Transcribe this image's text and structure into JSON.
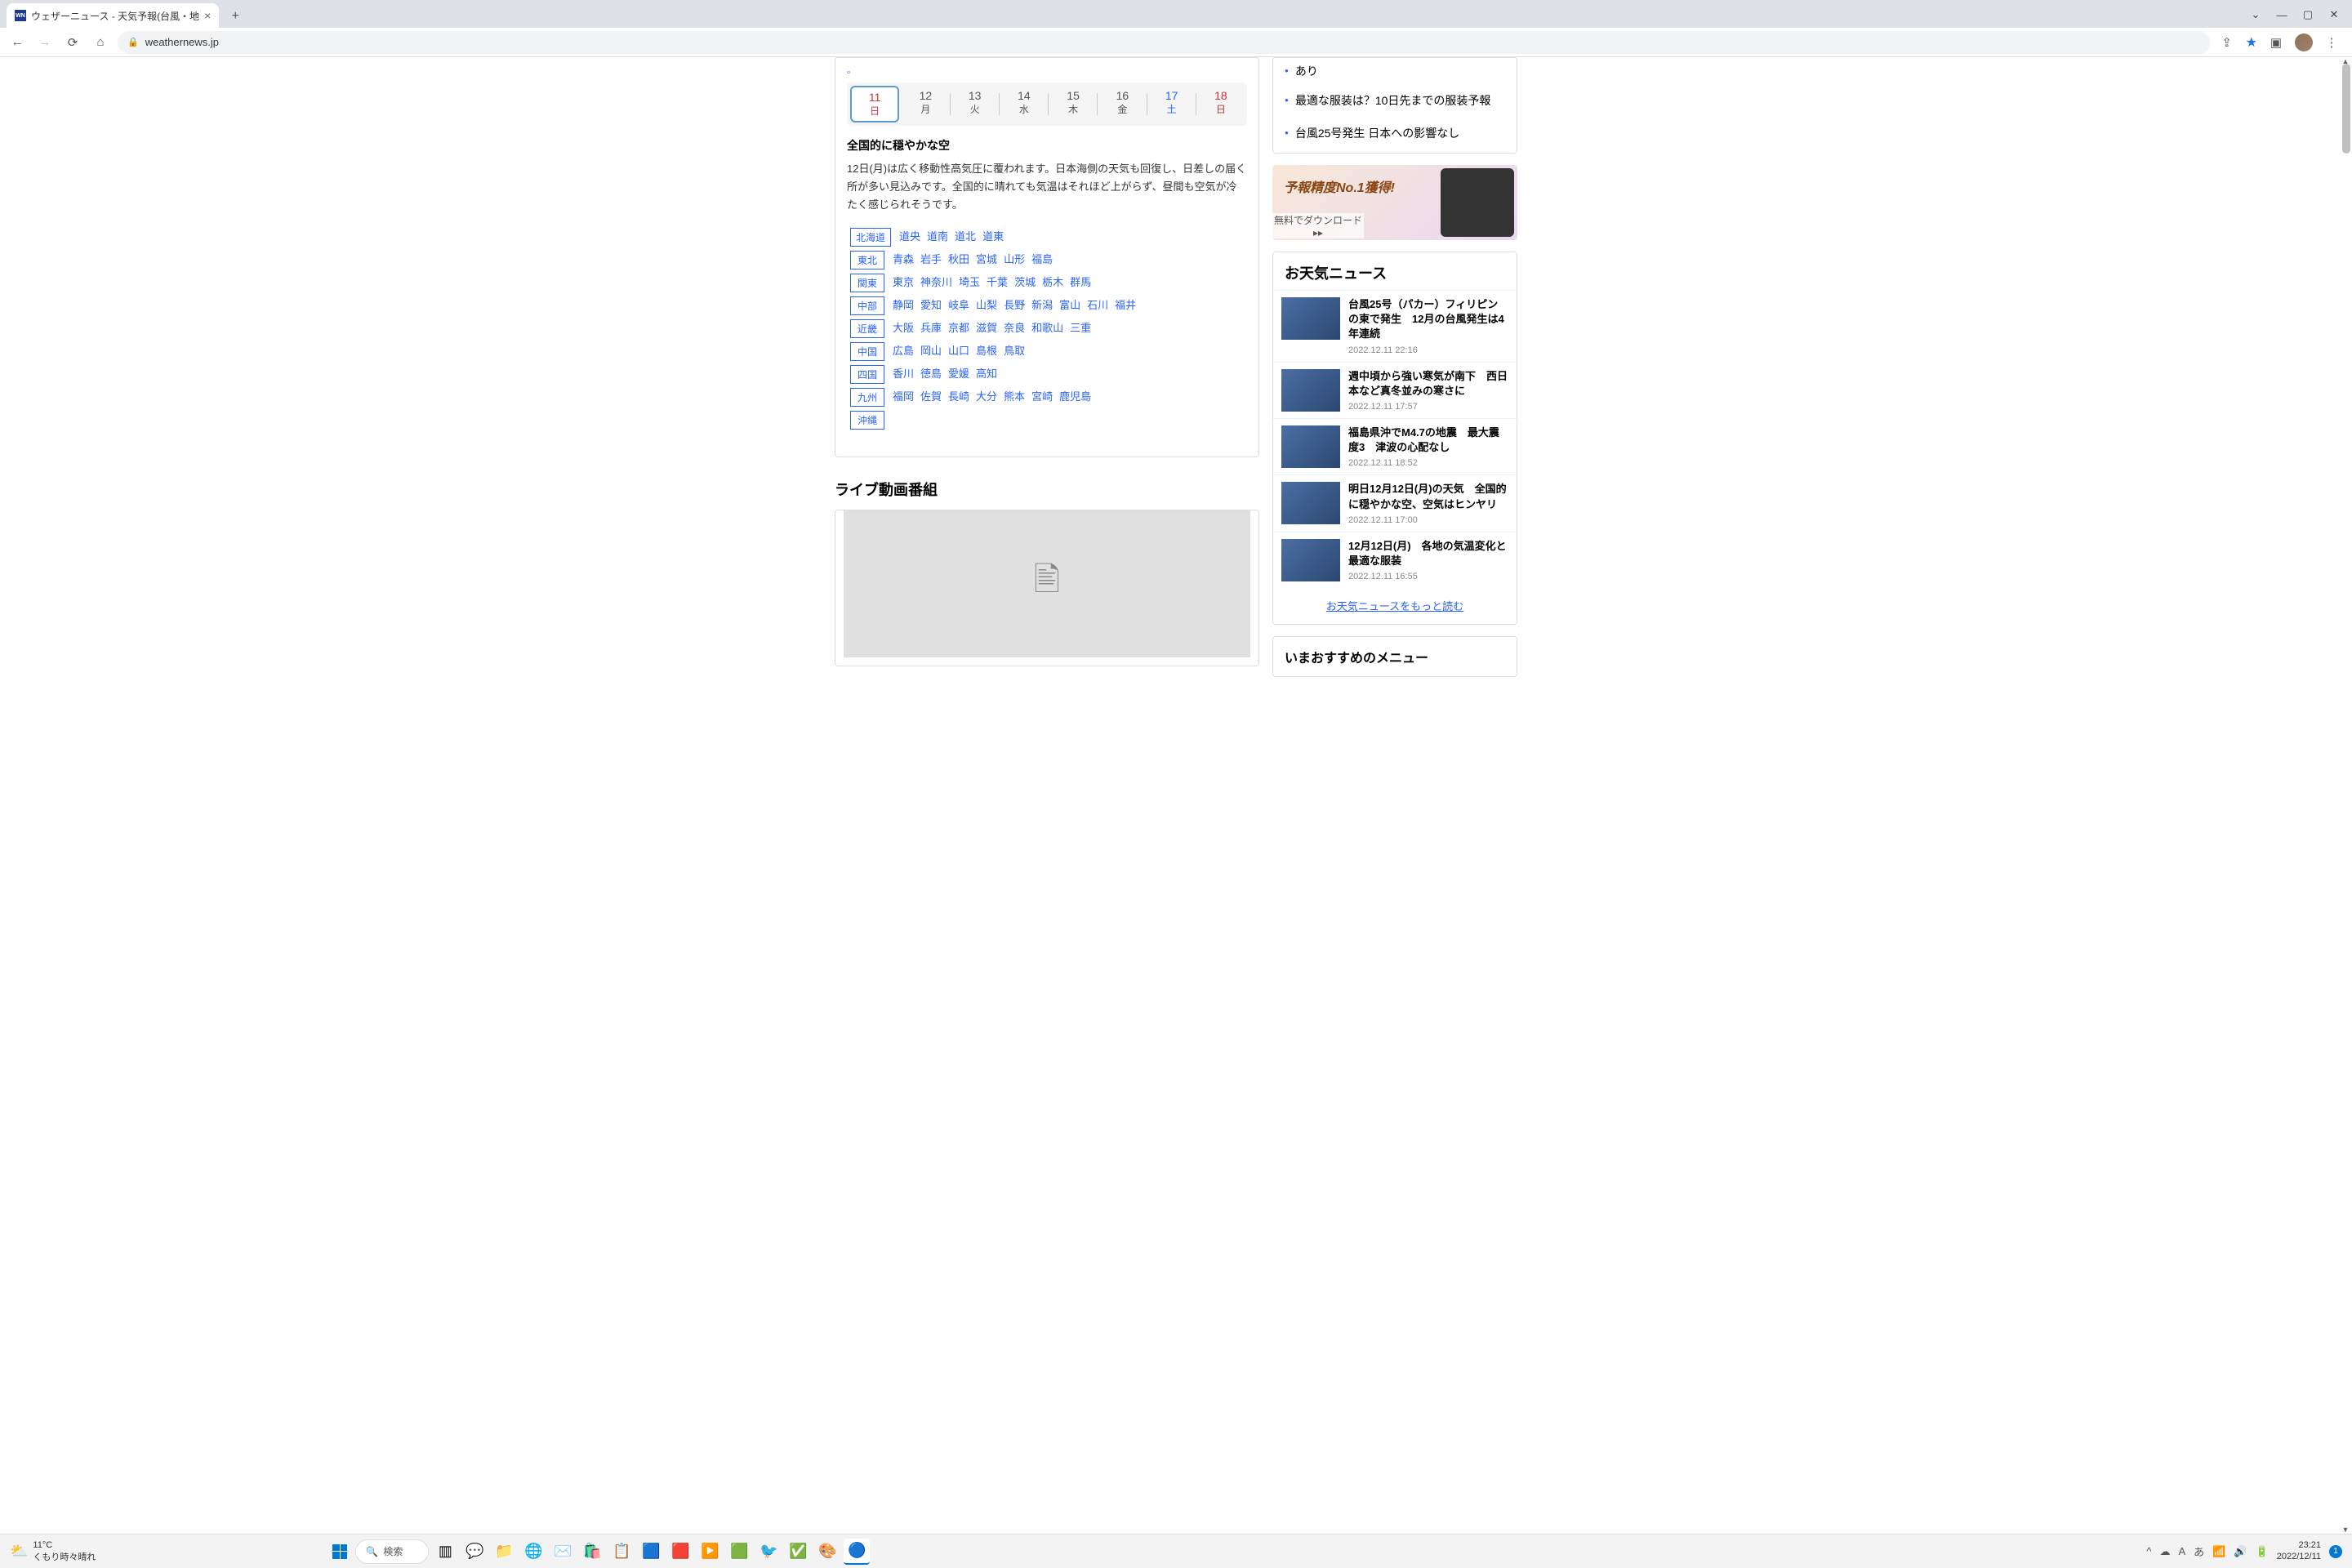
{
  "browser": {
    "tab_title": "ウェザーニュース - 天気予報(台風・地",
    "url": "weathernews.jp",
    "favicon_text": "WN"
  },
  "dates": [
    {
      "num": "11",
      "day": "日",
      "cls": "sun",
      "active": true
    },
    {
      "num": "12",
      "day": "月",
      "cls": "wd"
    },
    {
      "num": "13",
      "day": "火",
      "cls": "wd"
    },
    {
      "num": "14",
      "day": "水",
      "cls": "wd"
    },
    {
      "num": "15",
      "day": "木",
      "cls": "wd"
    },
    {
      "num": "16",
      "day": "金",
      "cls": "wd"
    },
    {
      "num": "17",
      "day": "土",
      "cls": "sat"
    },
    {
      "num": "18",
      "day": "日",
      "cls": "sun"
    }
  ],
  "forecast": {
    "title": "全国的に穏やかな空",
    "body": "12日(月)は広く移動性高気圧に覆われます。日本海側の天気も回復し、日差しの届く所が多い見込みです。全国的に晴れても気温はそれほど上がらず、昼間も空気が冷たく感じられそうです。"
  },
  "regions": [
    {
      "label": "北海道",
      "links": [
        "道央",
        "道南",
        "道北",
        "道東"
      ]
    },
    {
      "label": "東北",
      "links": [
        "青森",
        "岩手",
        "秋田",
        "宮城",
        "山形",
        "福島"
      ]
    },
    {
      "label": "関東",
      "links": [
        "東京",
        "神奈川",
        "埼玉",
        "千葉",
        "茨城",
        "栃木",
        "群馬"
      ]
    },
    {
      "label": "中部",
      "links": [
        "静岡",
        "愛知",
        "岐阜",
        "山梨",
        "長野",
        "新潟",
        "富山",
        "石川",
        "福井"
      ]
    },
    {
      "label": "近畿",
      "links": [
        "大阪",
        "兵庫",
        "京都",
        "滋賀",
        "奈良",
        "和歌山",
        "三重"
      ]
    },
    {
      "label": "中国",
      "links": [
        "広島",
        "岡山",
        "山口",
        "島根",
        "鳥取"
      ]
    },
    {
      "label": "四国",
      "links": [
        "香川",
        "徳島",
        "愛媛",
        "高知"
      ]
    },
    {
      "label": "九州",
      "links": [
        "福岡",
        "佐賀",
        "長崎",
        "大分",
        "熊本",
        "宮崎",
        "鹿児島"
      ]
    },
    {
      "label": "沖縄",
      "links": []
    }
  ],
  "live_title": "ライブ動画番組",
  "sidebar_topics": [
    "最適な服装は？10日先までの服装予報",
    "台風25号発生 日本への影響なし"
  ],
  "sidebar_topic_cut": "あり",
  "promo": {
    "headline": "予報精度No.1獲得!",
    "download": "無料でダウンロード ▸▸"
  },
  "news_title": "お天気ニュース",
  "news": [
    {
      "title": "台風25号（パカー）フィリピンの東で発生　12月の台風発生は4年連続",
      "date": "2022.12.11 22:16"
    },
    {
      "title": "週中頃から強い寒気が南下　西日本など真冬並みの寒さに",
      "date": "2022.12.11 17:57"
    },
    {
      "title": "福島県沖でM4.7の地震　最大震度3　津波の心配なし",
      "date": "2022.12.11 18:52"
    },
    {
      "title": "明日12月12日(月)の天気　全国的に穏やかな空、空気はヒンヤリ",
      "date": "2022.12.11 17:00"
    },
    {
      "title": "12月12日(月)　各地の気温変化と最適な服装",
      "date": "2022.12.11 16:55"
    }
  ],
  "news_more": "お天気ニュースをもっと読む",
  "recommend_title": "いまおすすめのメニュー",
  "taskbar": {
    "weather_temp": "11°C",
    "weather_text": "くもり時々晴れ",
    "search": "検索",
    "time": "23:21",
    "date": "2022/12/11",
    "notif": "1"
  }
}
